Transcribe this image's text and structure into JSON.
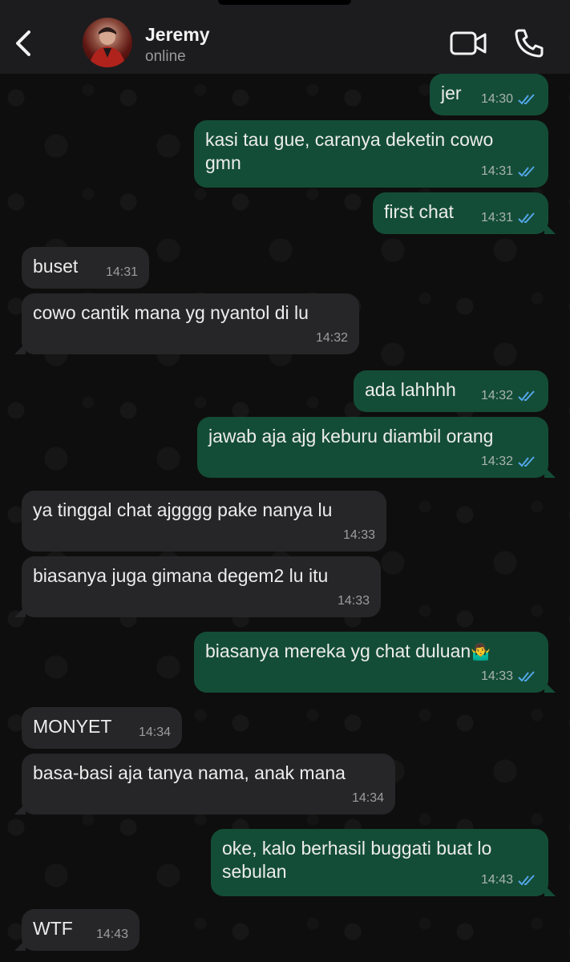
{
  "header": {
    "contact_name": "Jeremy",
    "status": "online"
  },
  "messages": [
    {
      "dir": "out",
      "text": "jer",
      "time": "14:30",
      "read": true
    },
    {
      "dir": "out",
      "text": "kasi tau gue, caranya deketin cowo",
      "text2": "gmn",
      "time": "14:31",
      "read": true
    },
    {
      "dir": "out",
      "text": "first chat",
      "time": "14:31",
      "read": true
    },
    {
      "dir": "in",
      "text": "buset",
      "time": "14:31"
    },
    {
      "dir": "in",
      "text": "cowo cantik mana yg nyantol di lu",
      "time": "14:32"
    },
    {
      "dir": "out",
      "text": "ada lahhhh",
      "time": "14:32",
      "read": true
    },
    {
      "dir": "out",
      "text": "jawab aja ajg keburu diambil orang",
      "time": "14:32",
      "read": true
    },
    {
      "dir": "in",
      "text": "ya tinggal chat ajgggg pake nanya lu",
      "time": "14:33"
    },
    {
      "dir": "in",
      "text": "biasanya juga gimana degem2 lu itu",
      "time": "14:33"
    },
    {
      "dir": "out",
      "text": "biasanya mereka yg chat duluan",
      "emoji": "🤷‍♂️",
      "time": "14:33",
      "read": true
    },
    {
      "dir": "in",
      "text": "MONYET",
      "time": "14:34"
    },
    {
      "dir": "in",
      "text": "basa-basi aja tanya nama, anak mana",
      "time": "14:34"
    },
    {
      "dir": "out",
      "text": "oke, kalo berhasil buggati buat lo",
      "text2": "sebulan",
      "time": "14:43",
      "read": true
    },
    {
      "dir": "in",
      "text": "WTF",
      "time": "14:43"
    }
  ],
  "colors": {
    "outgoing_bubble": "#144d37",
    "incoming_bubble": "#262628",
    "read_ticks": "#53a7ea",
    "header_bg": "#1c1c1e"
  }
}
